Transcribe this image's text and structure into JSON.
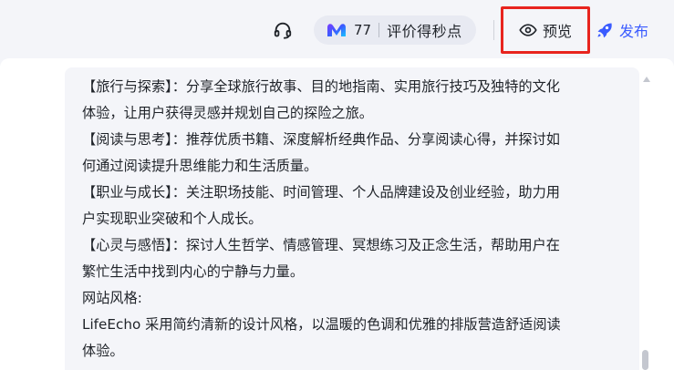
{
  "toolbar": {
    "support_icon": "headset-icon",
    "points": {
      "logo_icon": "brand-m-logo-icon",
      "count": "77",
      "label": "评价得秒点"
    },
    "preview": {
      "icon": "eye-icon",
      "label": "预览"
    },
    "publish": {
      "icon": "rocket-icon",
      "label": "发布",
      "color": "#3a5bff"
    },
    "highlight_color": "#e8241e"
  },
  "content": {
    "lines": [
      "【旅行与探索】：分享全球旅行故事、目的地指南、实用旅行技巧及独特的文化",
      "体验，让用户获得灵感并规划自己的探险之旅。",
      "【阅读与思考】：推荐优质书籍、深度解析经典作品、分享阅读心得，并探讨如",
      "何通过阅读提升思维能力和生活质量。",
      "【职业与成长】：关注职场技能、时间管理、个人品牌建设及创业经验，助力用",
      "户实现职业突破和个人成长。",
      "【心灵与感悟】：探讨人生哲学、情感管理、冥想练习及正念生活，帮助用户在",
      "繁忙生活中找到内心的宁静与力量。",
      "网站风格:",
      "LifeEcho 采用简约清新的设计风格，以温暖的色调和优雅的排版营造舒适阅读",
      "体验。"
    ]
  }
}
